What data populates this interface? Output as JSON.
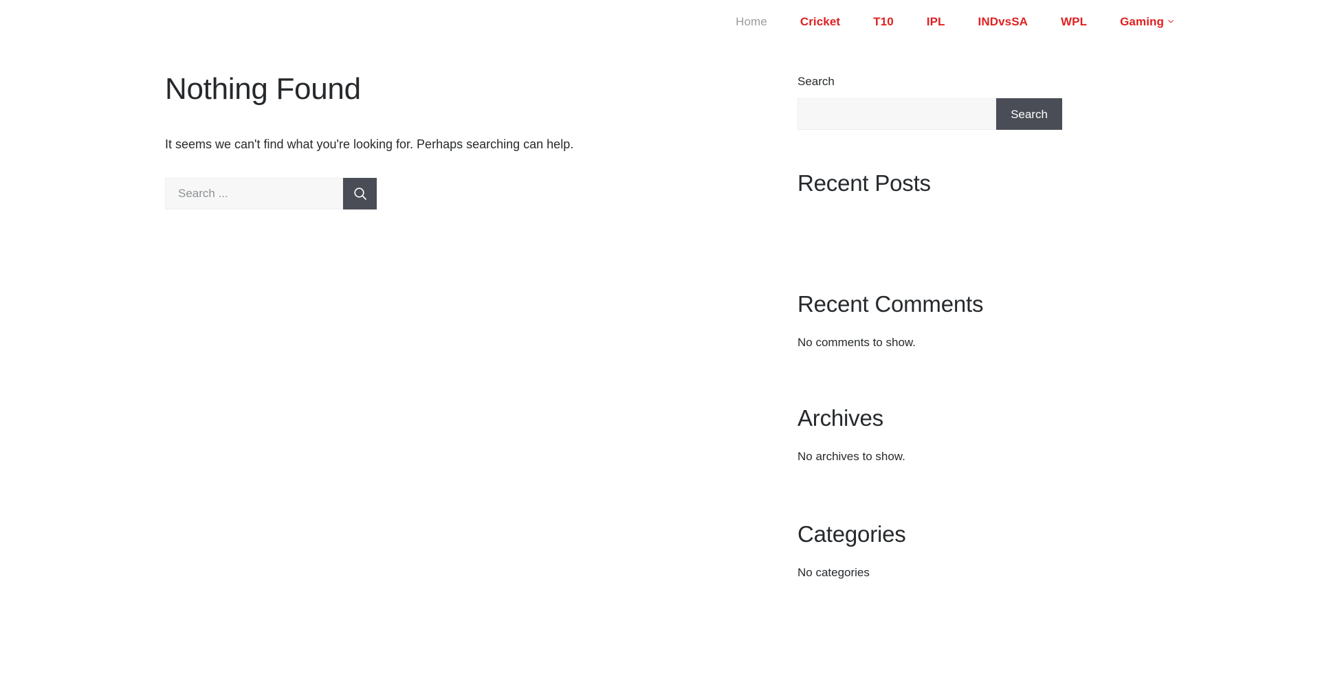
{
  "header": {
    "nav": [
      {
        "label": "Home",
        "current": true
      },
      {
        "label": "Cricket",
        "current": false
      },
      {
        "label": "T10",
        "current": false
      },
      {
        "label": "IPL",
        "current": false
      },
      {
        "label": "INDvsSA",
        "current": false
      },
      {
        "label": "WPL",
        "current": false
      },
      {
        "label": "Gaming",
        "current": false,
        "has_dropdown": true
      }
    ],
    "accent_color": "#e02020",
    "current_color": "#9b9b9b"
  },
  "main": {
    "title": "Nothing Found",
    "intro": "It seems we can't find what you're looking for. Perhaps searching can help.",
    "search": {
      "value": "",
      "placeholder": "Search ...",
      "submit_icon": "search-icon",
      "button_color": "#4a4d55"
    }
  },
  "sidebar": {
    "search_widget": {
      "label": "Search",
      "input_value": "",
      "input_placeholder": "",
      "button_label": "Search",
      "button_color": "#4a4d55"
    },
    "widgets": [
      {
        "title": "Recent Posts",
        "empty_text": "",
        "has_list": true
      },
      {
        "title": "Recent Comments",
        "empty_text": "No comments to show.",
        "has_list": false
      },
      {
        "title": "Archives",
        "empty_text": "No archives to show.",
        "has_list": false
      },
      {
        "title": "Categories",
        "empty_text": "No categories",
        "has_list": false
      }
    ]
  }
}
